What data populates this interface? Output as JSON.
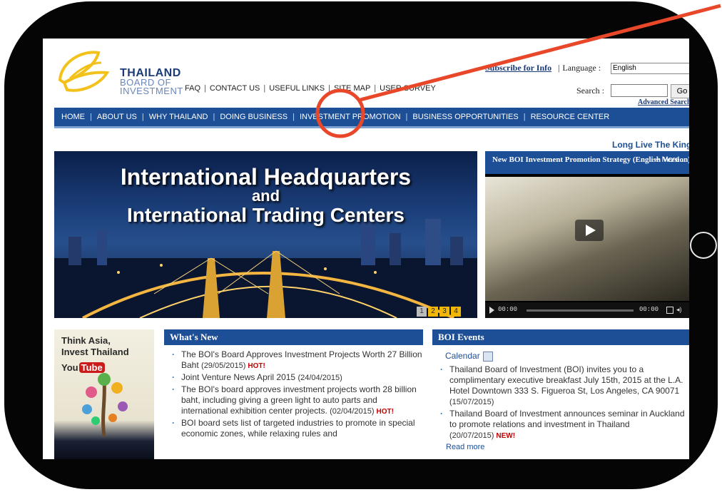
{
  "logo": {
    "line1": "THAILAND",
    "line2": "BOARD OF",
    "line3": "INVESTMENT"
  },
  "top_links": [
    "FAQ",
    "CONTACT US",
    "USEFUL LINKS",
    "SITE MAP",
    "USER SURVEY"
  ],
  "header": {
    "subscribe": "Subscribe for Info",
    "language_label": "Language :",
    "language_value": "English",
    "search_label": "Search :",
    "search_placeholder": "",
    "go_label": "Go",
    "advanced_search": "Advanced Search"
  },
  "main_nav": [
    "HOME",
    "ABOUT US",
    "WHY THAILAND",
    "DOING BUSINESS",
    "INVESTMENT PROMOTION",
    "BUSINESS OPPORTUNITIES",
    "RESOURCE CENTER"
  ],
  "ticker": "Long Live The King",
  "banner": {
    "line1": "International Headquarters",
    "line2": "and",
    "line3": "International Trading Centers",
    "pages": [
      "1",
      "2",
      "3",
      "4"
    ]
  },
  "video": {
    "title": "New BOI Investment Promotion Strategy (English Version)",
    "more": "+ More...",
    "time_current": "00:00",
    "time_total": "00:00"
  },
  "promo": {
    "line1": "Think Asia,",
    "line2": "Invest Thailand",
    "you": "You",
    "tube": "Tube"
  },
  "whats_new": {
    "title": "What's New",
    "items": [
      {
        "text": "The BOI's Board Approves Investment Projects Worth 27 Billion Baht",
        "date": "(29/05/2015)",
        "badge": "HOT!"
      },
      {
        "text": "Joint Venture News April 2015",
        "date": "(24/04/2015)",
        "badge": ""
      },
      {
        "text": "The BOI's board approves investment projects worth 28 billion baht, including giving a green light to auto parts and international exhibition center projects.",
        "date": "(02/04/2015)",
        "badge": "HOT!"
      },
      {
        "text": "BOI board sets list of targeted industries to promote in special economic zones, while relaxing rules and",
        "date": "",
        "badge": ""
      }
    ]
  },
  "boi_events": {
    "title": "BOI Events",
    "calendar": "Calendar",
    "items": [
      {
        "text": "Thailand Board of Investment (BOI) invites you to a complimentary executive breakfast July 15th, 2015 at the L.A. Hotel Downtown 333 S. Figueroa St, Los Angeles, CA 90071",
        "date": "(15/07/2015)",
        "badge": ""
      },
      {
        "text": "Thailand Board of Investment announces seminar in Auckland to promote relations and investment in Thailand",
        "date": "(20/07/2015)",
        "badge": "NEW!"
      }
    ],
    "read_more": "Read more"
  },
  "colors": {
    "nav_blue": "#1d4f96",
    "annotation_red": "#e8472a",
    "hot_red": "#c40000",
    "logo_yellow": "#f2c21b"
  }
}
